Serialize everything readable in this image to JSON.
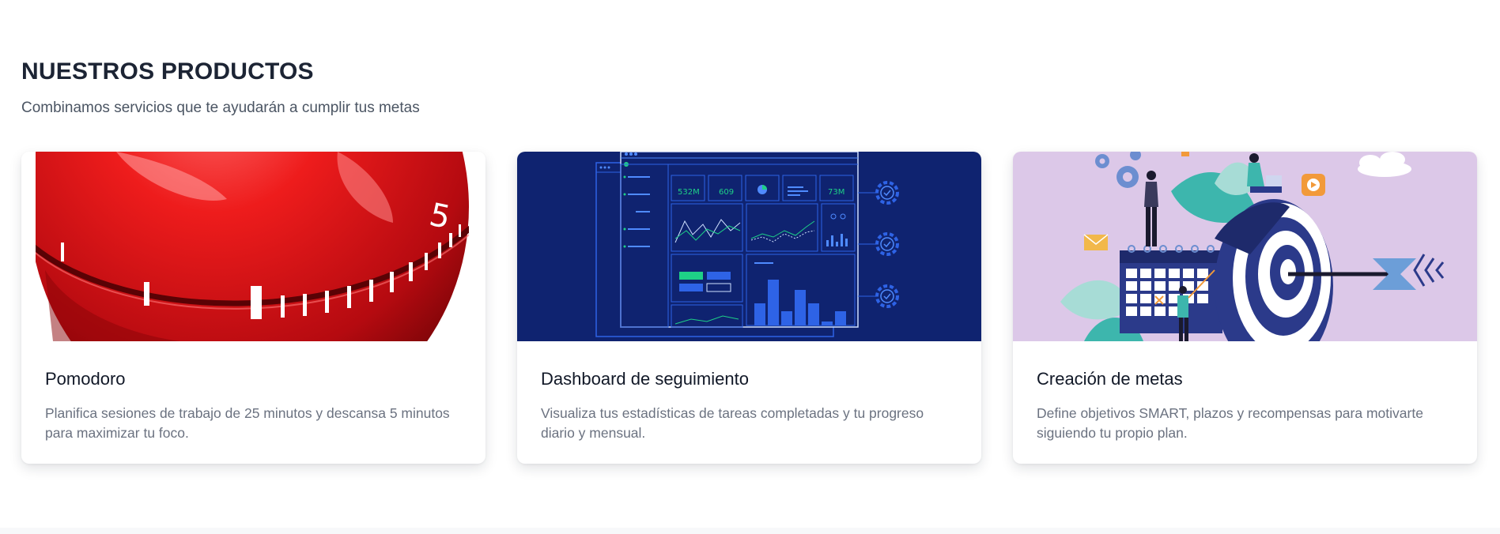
{
  "section": {
    "title": "NUESTROS PRODUCTOS",
    "subtitle": "Combinamos servicios que te ayudarán a cumplir tus metas"
  },
  "cards": [
    {
      "title": "Pomodoro",
      "description": "Planifica sesiones de trabajo de 25 minutos y descansa 5 minutos para maximizar tu foco.",
      "image_icon": "tomato-timer-image"
    },
    {
      "title": "Dashboard de seguimiento",
      "description": "Visualiza tus estadísticas de tareas completadas y tu progreso diario y mensual.",
      "image_icon": "dashboard-illustration-image",
      "image_labels": [
        "532M",
        "609",
        "73M"
      ]
    },
    {
      "title": "Creación de metas",
      "description": "Define objetivos SMART, plazos y recompensas para motivarte siguiendo tu propio plan.",
      "image_icon": "goal-target-illustration-image"
    }
  ],
  "image_text": {
    "timer_number": "5"
  },
  "colors": {
    "heading": "#1c2434",
    "text_muted": "#6b7280",
    "dashboard_bg": "#0f2370",
    "goals_bg": "#dcc8e8",
    "timer_red": "#d6141a"
  }
}
